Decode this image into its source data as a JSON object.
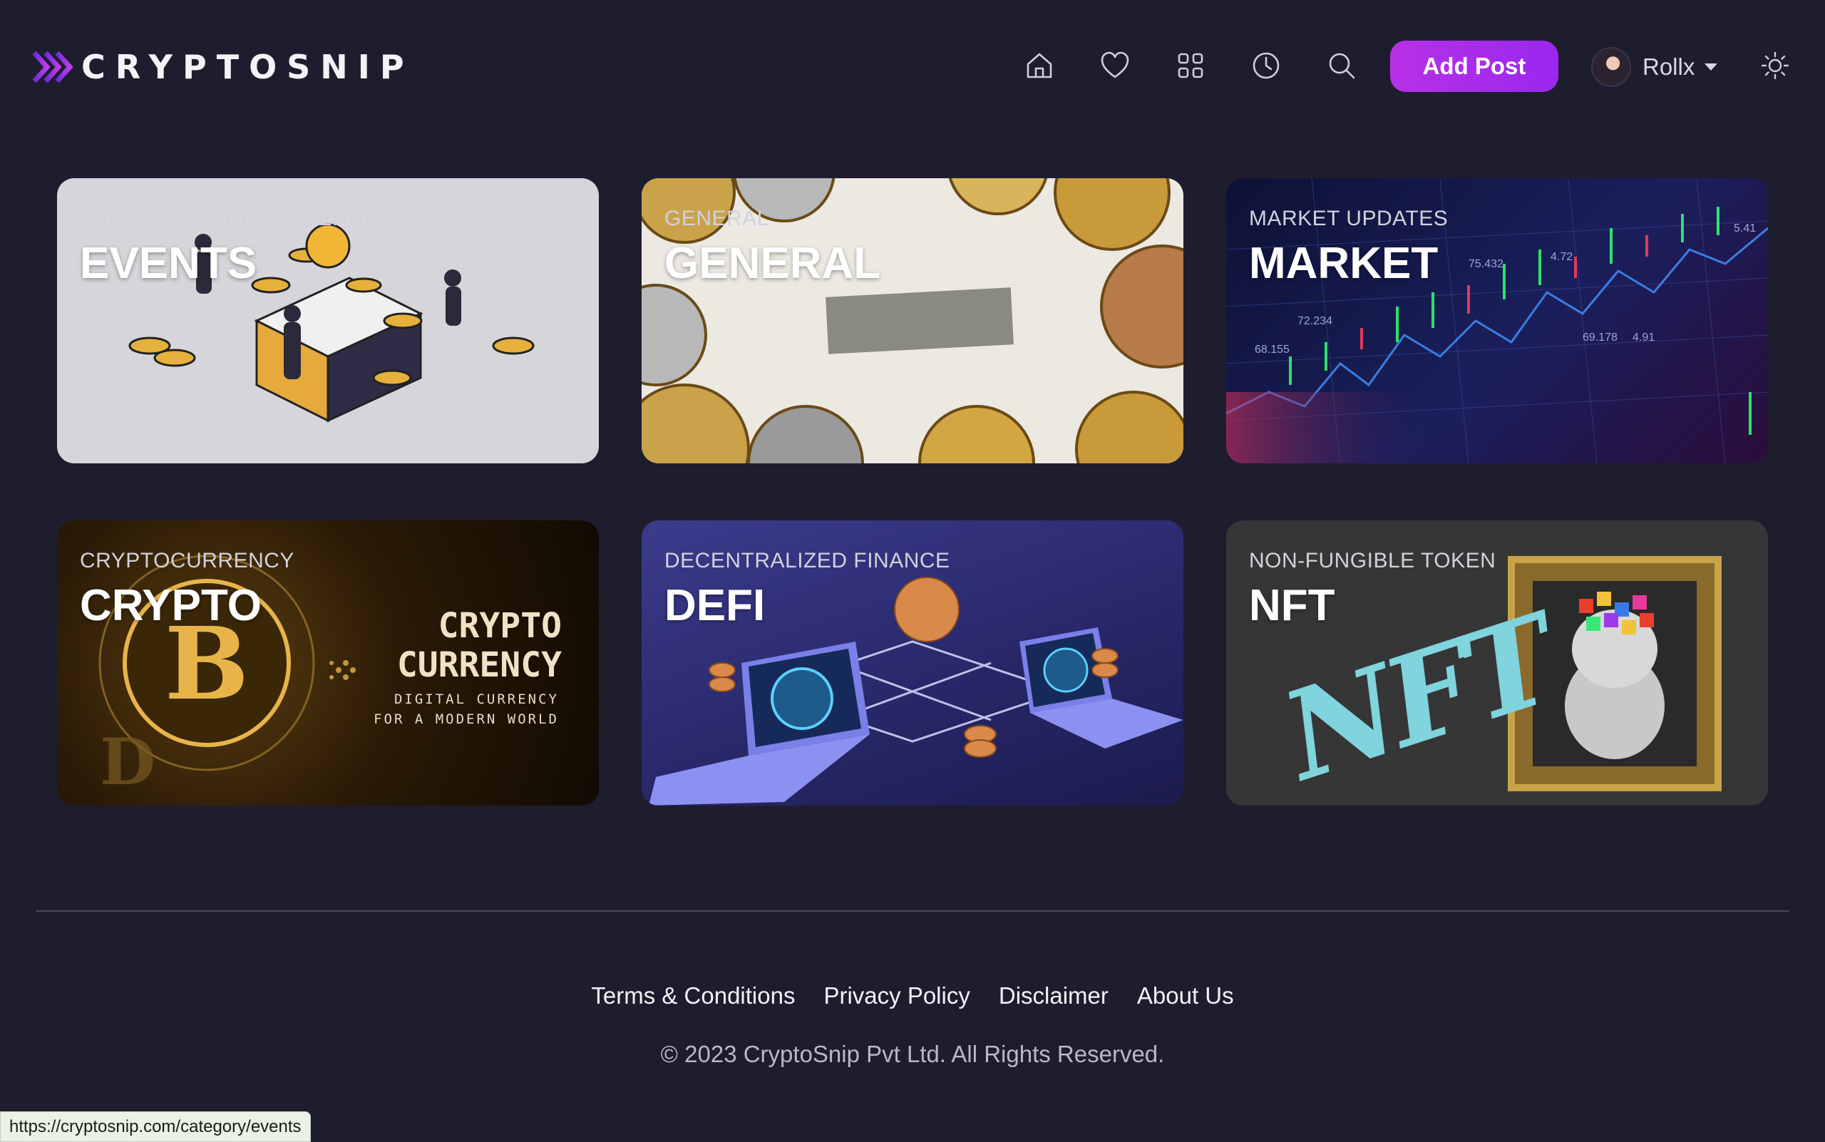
{
  "app": {
    "logo_text": "CRYPTOSNIP",
    "brand_color": "#a82ee8",
    "background_color": "#1e1d2e"
  },
  "nav": {
    "icons": [
      "home-icon",
      "heart-icon",
      "grid-icon",
      "clock-icon",
      "search-icon"
    ],
    "add_post_label": "Add Post",
    "user_name": "Rollx",
    "theme_icon": "sun-icon"
  },
  "categories": [
    {
      "eyebrow": "EVENTS AND CONFERENCES",
      "title": "EVENTS"
    },
    {
      "eyebrow": "GENERAL",
      "title": "GENERAL"
    },
    {
      "eyebrow": "MARKET UPDATES",
      "title": "MARKET"
    },
    {
      "eyebrow": "CRYPTOCURRENCY",
      "title": "CRYPTO"
    },
    {
      "eyebrow": "DECENTRALIZED FINANCE",
      "title": "DEFI"
    },
    {
      "eyebrow": "NON-FUNGIBLE TOKEN",
      "title": "NFT"
    }
  ],
  "card_art": {
    "market_ticks": [
      "5.41",
      "75.432",
      "4.72",
      "72.234",
      "68.155",
      "69.178",
      "4.91"
    ],
    "crypto_headline_1": "CRYPTO",
    "crypto_headline_2": "CURRENCY",
    "crypto_tagline_1": "DIGITAL CURRENCY",
    "crypto_tagline_2": "FOR A MODERN WORLD",
    "nft_script": "NFT"
  },
  "footer": {
    "links": [
      "Terms & Conditions",
      "Privacy Policy",
      "Disclaimer",
      "About Us"
    ],
    "copyright": "© 2023 CryptoSnip Pvt Ltd. All Rights Reserved."
  },
  "status_bar": {
    "url": "https://cryptosnip.com/category/events"
  }
}
